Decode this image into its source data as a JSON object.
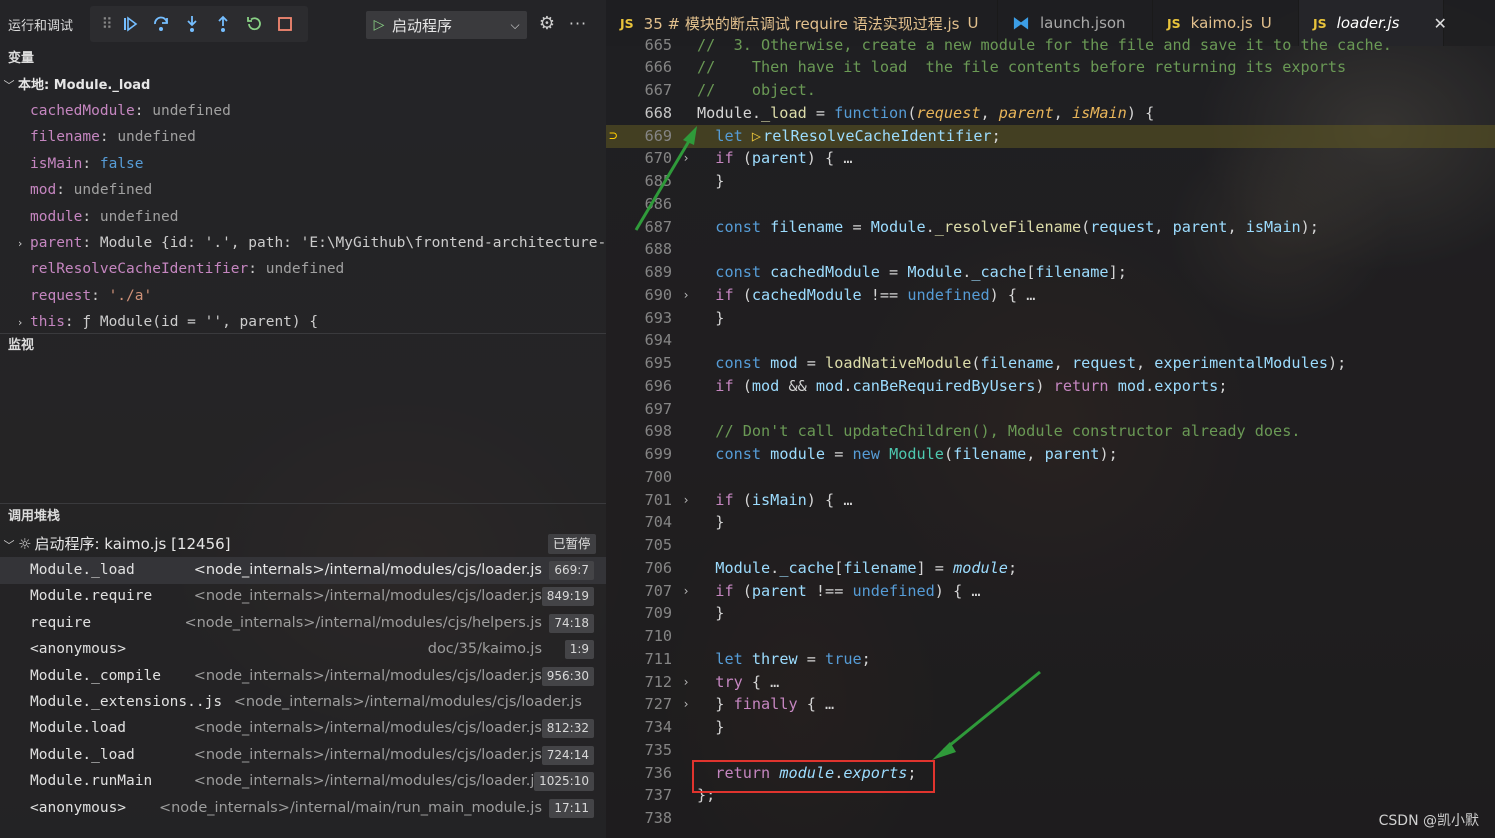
{
  "debug": {
    "title": "运行和调试",
    "launch_config": "启动程序"
  },
  "sections": {
    "variables": "变量",
    "watch": "监视",
    "callstack": "调用堆栈"
  },
  "scope": {
    "label": "本地: Module._load",
    "vars": [
      {
        "name": "cachedModule",
        "value": "undefined",
        "kind": "undef",
        "expandable": false
      },
      {
        "name": "filename",
        "value": "undefined",
        "kind": "undef",
        "expandable": false
      },
      {
        "name": "isMain",
        "value": "false",
        "kind": "bool",
        "expandable": false
      },
      {
        "name": "mod",
        "value": "undefined",
        "kind": "undef",
        "expandable": false
      },
      {
        "name": "module",
        "value": "undefined",
        "kind": "undef",
        "expandable": false
      },
      {
        "name": "parent",
        "value": "Module {id: '.', path: 'E:\\MyGithub\\frontend-architecture-…",
        "kind": "obj",
        "expandable": true
      },
      {
        "name": "relResolveCacheIdentifier",
        "value": "undefined",
        "kind": "undef",
        "expandable": false
      },
      {
        "name": "request",
        "value": "'./a'",
        "kind": "str",
        "expandable": false
      },
      {
        "name": "this",
        "value": "ƒ Module(id = '', parent) {",
        "kind": "obj",
        "expandable": true
      }
    ]
  },
  "callstack": {
    "thread": "启动程序: kaimo.js [12456]",
    "status": "已暂停",
    "frames": [
      {
        "fn": "Module._load",
        "src": "<node_internals>/internal/modules/cjs/loader.js",
        "loc": "669:7"
      },
      {
        "fn": "Module.require",
        "src": "<node_internals>/internal/modules/cjs/loader.js",
        "loc": "849:19"
      },
      {
        "fn": "require",
        "src": "<node_internals>/internal/modules/cjs/helpers.js",
        "loc": "74:18"
      },
      {
        "fn": "<anonymous>",
        "src": "doc/35/kaimo.js",
        "loc": "1:9"
      },
      {
        "fn": "Module._compile",
        "src": "<node_internals>/internal/modules/cjs/loader.js",
        "loc": "956:30"
      },
      {
        "fn": "Module._extensions..js",
        "src": "<node_internals>/internal/modules/cjs/loader.js",
        "loc": ""
      },
      {
        "fn": "Module.load",
        "src": "<node_internals>/internal/modules/cjs/loader.js",
        "loc": "812:32"
      },
      {
        "fn": "Module._load",
        "src": "<node_internals>/internal/modules/cjs/loader.js",
        "loc": "724:14"
      },
      {
        "fn": "Module.runMain",
        "src": "<node_internals>/internal/modules/cjs/loader.js",
        "loc": "1025:10"
      },
      {
        "fn": "<anonymous>",
        "src": "<node_internals>/internal/main/run_main_module.js",
        "loc": "17:11"
      }
    ]
  },
  "tabs": [
    {
      "icon": "JS",
      "title": "35 # 模块的断点调试 require 语法实现过程.js",
      "badge": "U"
    },
    {
      "icon": "vscode",
      "title": "launch.json",
      "badge": ""
    },
    {
      "icon": "JS",
      "title": "kaimo.js",
      "badge": "U"
    },
    {
      "icon": "JS",
      "title": "loader.js",
      "badge": "",
      "close": "✕"
    }
  ],
  "editor": {
    "line_numbers": [
      "665",
      "666",
      "667",
      "668",
      "669",
      "670",
      "685",
      "686",
      "687",
      "688",
      "689",
      "690",
      "693",
      "694",
      "695",
      "696",
      "697",
      "698",
      "699",
      "700",
      "701",
      "704",
      "705",
      "706",
      "707",
      "709",
      "710",
      "711",
      "712",
      "727",
      "734",
      "735",
      "736",
      "737",
      "738"
    ],
    "comment_top": "//  3. Otherwise, create a new module for the file and save it to the cache.",
    "comment_1": "//    Then have it load  the file contents before returning its exports",
    "comment_2": "//    object.",
    "comment_3": "// Don't call updateChildren(), Module constructor already does.",
    "fold_ellipsis": "…"
  },
  "watermark": "CSDN @凯小默"
}
